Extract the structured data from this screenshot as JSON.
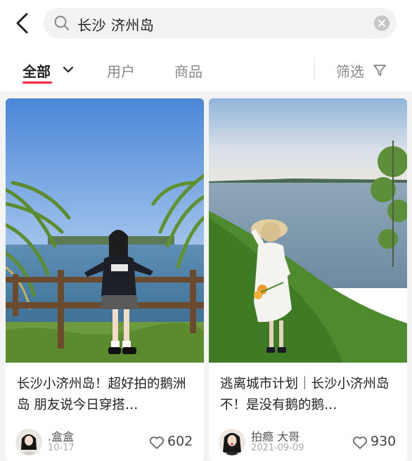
{
  "search": {
    "query": "长沙 济州岛"
  },
  "tabs": {
    "all": "全部",
    "users": "用户",
    "products": "商品",
    "filter": "筛选"
  },
  "colors": {
    "accent": "#ff2442"
  },
  "icons": [
    "back-arrow-icon",
    "search-icon",
    "clear-icon",
    "chevron-down-icon",
    "filter-funnel-icon",
    "heart-icon"
  ],
  "cards": [
    {
      "title": "长沙小济州岛！超好拍的鹅洲岛 朋友说今日穿搭…",
      "author": ".盒盒",
      "date": "10-17",
      "likes": "602"
    },
    {
      "title": "逃离城市计划｜长沙小济州岛 不！是没有鹅的鹅…",
      "author": "拍瘾 大哥",
      "date": "2021-09-09",
      "likes": "930"
    }
  ]
}
